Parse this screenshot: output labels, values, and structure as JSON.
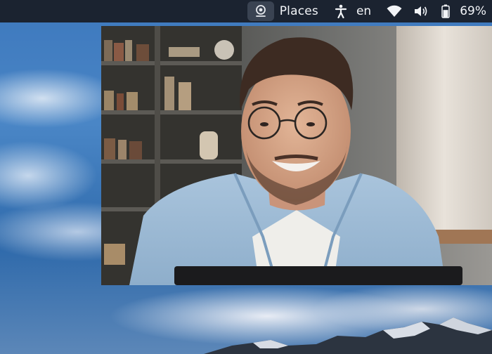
{
  "topbar": {
    "places_label": "Places",
    "language": "en",
    "battery_percent": "69%",
    "battery_level": 0.69,
    "icons": {
      "indicator": "webcam-indicator-icon",
      "accessibility": "accessibility-icon",
      "network": "wifi-icon",
      "volume": "volume-icon",
      "battery": "battery-icon"
    }
  },
  "colors": {
    "topbar_bg": "#1b2330",
    "topbar_text": "#f2f4f7",
    "sky": "#3d78bd"
  }
}
